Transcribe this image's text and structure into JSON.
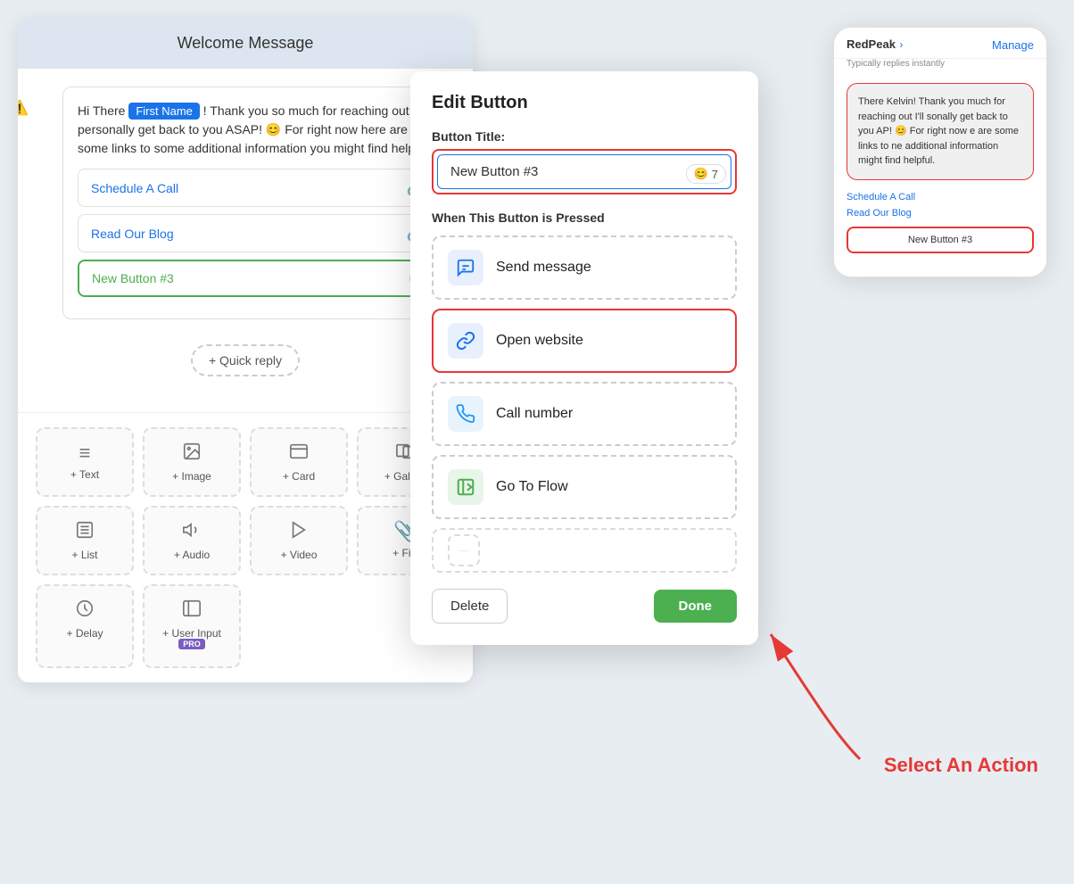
{
  "canvas": {
    "background": "#e8edf2"
  },
  "flow_panel": {
    "header_title": "Welcome Message",
    "message": {
      "greeting_prefix": "Hi There ",
      "first_name_badge": "First Name",
      "greeting_suffix": "! Thank you so much for reaching out I'll personally get back to you ASAP! 😊 For right now here are some links to some additional information you might find helpful.",
      "buttons": [
        {
          "label": "Schedule A Call",
          "has_link": true
        },
        {
          "label": "Read Our Blog",
          "has_link": true
        },
        {
          "label": "New Button #3",
          "is_new": true
        }
      ]
    },
    "quick_reply_label": "+ Quick reply"
  },
  "blocks_grid": {
    "items": [
      {
        "icon": "≡",
        "label": "+ Text"
      },
      {
        "icon": "🖼",
        "label": "+ Image"
      },
      {
        "icon": "▭",
        "label": "+ Card"
      },
      {
        "icon": "⊞",
        "label": "+ Gallery"
      },
      {
        "icon": "⊞",
        "label": "+ List"
      },
      {
        "icon": "🔈",
        "label": "+ Audio"
      },
      {
        "icon": "▶",
        "label": "+ Video"
      },
      {
        "icon": "📎",
        "label": "+ File"
      },
      {
        "icon": "⏱",
        "label": "+ Delay"
      },
      {
        "icon": "📋",
        "label": "+ User Input",
        "has_pro": true
      }
    ]
  },
  "modal": {
    "title": "Edit Button",
    "button_title_label": "Button Title:",
    "button_title_value": "New Button #3",
    "emoji_count": "7",
    "when_pressed_label": "When This Button is Pressed",
    "actions": [
      {
        "id": "send_message",
        "label": "Send message",
        "icon_type": "msg"
      },
      {
        "id": "open_website",
        "label": "Open website",
        "icon_type": "web",
        "selected": true
      },
      {
        "id": "call_number",
        "label": "Call number",
        "icon_type": "call"
      },
      {
        "id": "go_to_flow",
        "label": "Go To Flow",
        "icon_type": "flow"
      }
    ],
    "delete_label": "Delete",
    "done_label": "Done"
  },
  "phone": {
    "brand": "RedPeak",
    "chevron": "›",
    "manage_label": "Manage",
    "status": "Typically replies instantly",
    "message_text": "There Kelvin! Thank you much for reaching out I'll sonally get back to you AP! 😊 For right now e are some links to ne additional information might find helpful.",
    "links": [
      "Schedule A Call",
      "Read Our Blog"
    ],
    "new_button": "New Button #3"
  },
  "annotation": {
    "select_action_text": "Select An Action"
  }
}
